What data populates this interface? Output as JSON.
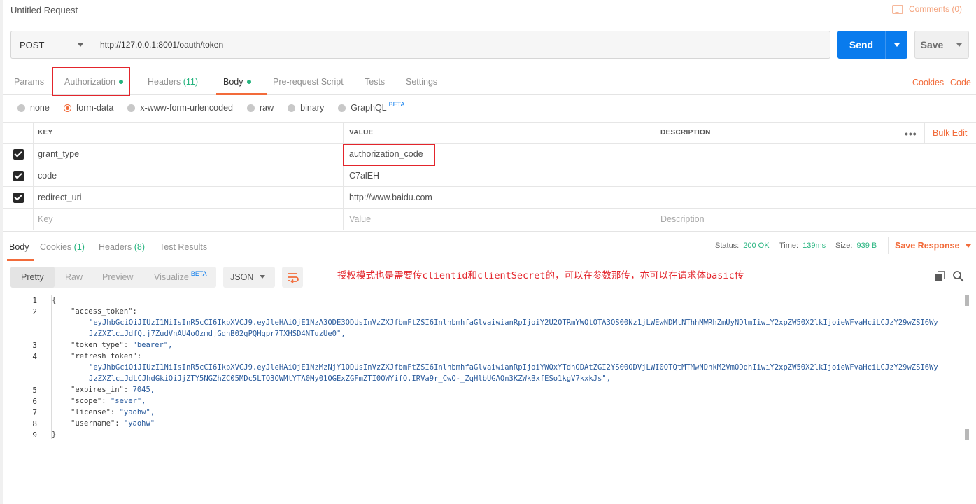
{
  "request": {
    "title": "Untitled Request",
    "comments_label": "Comments (0)",
    "method": "POST",
    "url": "http://127.0.0.1:8001/oauth/token",
    "send_label": "Send",
    "save_label": "Save"
  },
  "request_tabs": {
    "params": "Params",
    "authorization": "Authorization",
    "headers": "Headers",
    "headers_count": "(11)",
    "body": "Body",
    "prerequest": "Pre-request Script",
    "tests": "Tests",
    "settings": "Settings",
    "cookies": "Cookies",
    "code": "Code",
    "active": "Body"
  },
  "body_types": {
    "none": "none",
    "form_data": "form-data",
    "urlencoded": "x-www-form-urlencoded",
    "raw": "raw",
    "binary": "binary",
    "graphql": "GraphQL",
    "graphql_badge": "BETA",
    "selected": "form-data"
  },
  "params_table": {
    "headers": {
      "key": "KEY",
      "value": "VALUE",
      "description": "DESCRIPTION"
    },
    "bulk_edit": "Bulk Edit",
    "rows": [
      {
        "checked": true,
        "key": "grant_type",
        "value": "authorization_code",
        "description": ""
      },
      {
        "checked": true,
        "key": "code",
        "value": "C7alEH",
        "description": ""
      },
      {
        "checked": true,
        "key": "redirect_uri",
        "value": "http://www.baidu.com",
        "description": ""
      }
    ],
    "placeholders": {
      "key": "Key",
      "value": "Value",
      "description": "Description"
    }
  },
  "response_tabs": {
    "body": "Body",
    "cookies": "Cookies",
    "cookies_count": "(1)",
    "headers": "Headers",
    "headers_count": "(8)",
    "test_results": "Test Results"
  },
  "response_status": {
    "status_label": "Status:",
    "status_value": "200 OK",
    "time_label": "Time:",
    "time_value": "139ms",
    "size_label": "Size:",
    "size_value": "939 B",
    "save_response": "Save Response"
  },
  "view_modes": {
    "pretty": "Pretty",
    "raw": "Raw",
    "preview": "Preview",
    "visualize": "Visualize",
    "visualize_badge": "BETA",
    "format": "JSON"
  },
  "annotation": "授权模式也是需要传clientid和clientSecret的，可以在参数那传，亦可以在请求体basic传",
  "response_body": {
    "line_numbers": [
      "1",
      "2",
      "3",
      "4",
      "5",
      "6",
      "7",
      "8",
      "9"
    ],
    "open_brace": "{",
    "close_brace": "}",
    "access_token_key": "\"access_token\"",
    "access_token_part1": "\"eyJhbGciOiJIUzI1NiIsInR5cCI6IkpXVCJ9.eyJleHAiOjE1NzA3ODE3ODUsInVzZXJfbmFtZSI6InlhbmhfaGlvaiwianRpIjoiY2U2OTRmYWQtOTA3OS00Nz1jLWEwNDMtNThhMWRhZmUyNDlmIiwiY2xpZW50X2lkIjoieWFvaHciLCJzY29wZSI6Wy",
    "access_token_part2": "JzZXZlciJdfQ.j7ZudVnAU4oOzmdjGqhB02gPQHgpr7TXHSD4NTuzUe0\",",
    "token_type_key": "\"token_type\"",
    "token_type_value": "\"bearer\",",
    "refresh_token_key": "\"refresh_token\"",
    "refresh_token_part1": "\"eyJhbGciOiJIUzI1NiIsInR5cCI6IkpXVCJ9.eyJleHAiOjE1NzMzNjY1ODUsInVzZXJfbmFtZSI6InlhbmhfaGlvaiwianRpIjoiYWQxYTdhODAtZGI2YS00ODVjLWI0OTQtMTMwNDhkM2VmODdhIiwiY2xpZW50X2lkIjoieWFvaHciLCJzY29wZSI6Wy",
    "refresh_token_part2": "JzZXZlciJdLCJhdGkiOiJjZTY5NGZhZC05MDc5LTQ3OWMtYTA0My01OGExZGFmZTI0OWYifQ.IRVa9r_CwQ-_ZqHlbUGAQn3KZWkBxfESo1kgV7kxkJs\",",
    "expires_in_key": "\"expires_in\"",
    "expires_in_value": "7045,",
    "scope_key": "\"scope\"",
    "scope_value": "\"sever\",",
    "license_key": "\"license\"",
    "license_value": "\"yaohw\",",
    "username_key": "\"username\"",
    "username_value": "\"yaohw\""
  },
  "colors": {
    "accent": "#f26b3a",
    "send": "#097bed",
    "success": "#26b47f",
    "annotation_red": "#e3252c"
  },
  "icons": [
    "comment-icon",
    "chevron-down-icon",
    "kebab-menu-icon",
    "wrap-lines-icon",
    "copy-icon",
    "search-icon",
    "checkbox-checked-icon"
  ]
}
